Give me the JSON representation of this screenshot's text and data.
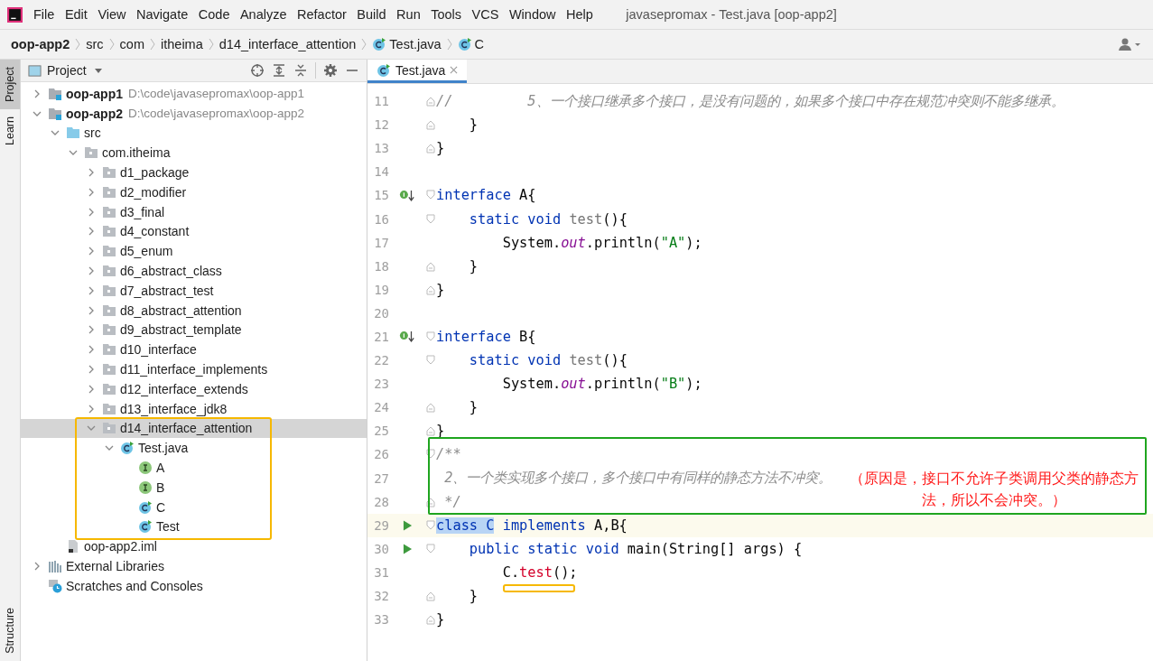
{
  "window": {
    "title": "javasepromax - Test.java [oop-app2]"
  },
  "menu": [
    "File",
    "Edit",
    "View",
    "Navigate",
    "Code",
    "Analyze",
    "Refactor",
    "Build",
    "Run",
    "Tools",
    "VCS",
    "Window",
    "Help"
  ],
  "breadcrumbs": [
    {
      "label": "oop-app2",
      "kind": "module"
    },
    {
      "label": "src",
      "kind": "folder"
    },
    {
      "label": "com",
      "kind": "folder"
    },
    {
      "label": "itheima",
      "kind": "folder"
    },
    {
      "label": "d14_interface_attention",
      "kind": "folder"
    },
    {
      "label": "Test.java",
      "kind": "class"
    },
    {
      "label": "C",
      "kind": "class"
    }
  ],
  "side_tabs": [
    {
      "label": "Project",
      "selected": true
    },
    {
      "label": "Learn",
      "selected": false
    }
  ],
  "bottom_side_tab": "Structure",
  "project": {
    "title": "Project",
    "tree": [
      {
        "label": "oop-app1",
        "path": "D:\\code\\javasepromax\\oop-app1",
        "kind": "module",
        "expanded": false,
        "selected": false
      },
      {
        "label": "oop-app2",
        "path": "D:\\code\\javasepromax\\oop-app2",
        "kind": "module",
        "expanded": true,
        "selected": false,
        "children": [
          {
            "label": "src",
            "kind": "source",
            "expanded": true,
            "selected": false,
            "children": [
              {
                "label": "com.itheima",
                "kind": "package",
                "expanded": true,
                "selected": false,
                "children": [
                  {
                    "label": "d1_package",
                    "kind": "package",
                    "expanded": false,
                    "selected": false
                  },
                  {
                    "label": "d2_modifier",
                    "kind": "package",
                    "expanded": false,
                    "selected": false
                  },
                  {
                    "label": "d3_final",
                    "kind": "package",
                    "expanded": false,
                    "selected": false
                  },
                  {
                    "label": "d4_constant",
                    "kind": "package",
                    "expanded": false,
                    "selected": false
                  },
                  {
                    "label": "d5_enum",
                    "kind": "package",
                    "expanded": false,
                    "selected": false
                  },
                  {
                    "label": "d6_abstract_class",
                    "kind": "package",
                    "expanded": false,
                    "selected": false
                  },
                  {
                    "label": "d7_abstract_test",
                    "kind": "package",
                    "expanded": false,
                    "selected": false
                  },
                  {
                    "label": "d8_abstract_attention",
                    "kind": "package",
                    "expanded": false,
                    "selected": false
                  },
                  {
                    "label": "d9_abstract_template",
                    "kind": "package",
                    "expanded": false,
                    "selected": false
                  },
                  {
                    "label": "d10_interface",
                    "kind": "package",
                    "expanded": false,
                    "selected": false
                  },
                  {
                    "label": "d11_interface_implements",
                    "kind": "package",
                    "expanded": false,
                    "selected": false
                  },
                  {
                    "label": "d12_interface_extends",
                    "kind": "package",
                    "expanded": false,
                    "selected": false
                  },
                  {
                    "label": "d13_interface_jdk8",
                    "kind": "package",
                    "expanded": false,
                    "selected": false
                  },
                  {
                    "label": "d14_interface_attention",
                    "kind": "package",
                    "expanded": true,
                    "selected": true,
                    "children": [
                      {
                        "label": "Test.java",
                        "kind": "class",
                        "expanded": true,
                        "selected": false,
                        "children": [
                          {
                            "label": "A",
                            "kind": "interface",
                            "selected": false
                          },
                          {
                            "label": "B",
                            "kind": "interface",
                            "selected": false
                          },
                          {
                            "label": "C",
                            "kind": "class",
                            "selected": false
                          },
                          {
                            "label": "Test",
                            "kind": "class",
                            "selected": false
                          }
                        ]
                      }
                    ]
                  }
                ]
              }
            ]
          },
          {
            "label": "oop-app2.iml",
            "kind": "file",
            "selected": false
          }
        ]
      },
      {
        "label": "External Libraries",
        "kind": "libraries",
        "expanded": false,
        "selected": false
      },
      {
        "label": "Scratches and Consoles",
        "kind": "scratches",
        "selected": false
      }
    ]
  },
  "editor_tabs": [
    {
      "label": "Test.java",
      "selected": true
    }
  ],
  "code": [
    {
      "number": "11",
      "current": false,
      "fold": {
        "kind": "close"
      },
      "tokens": [
        {
          "t": "//         5、一个接口继承多个接口，是没有问题的，如果多个接口中存在规范冲突则不能多继承。",
          "kind": "comment"
        }
      ]
    },
    {
      "number": "12",
      "current": false,
      "fold": {
        "kind": "close"
      },
      "tokens": [
        {
          "t": "    }",
          "kind": "plain"
        }
      ]
    },
    {
      "number": "13",
      "current": false,
      "fold": {
        "kind": "close"
      },
      "tokens": [
        {
          "t": "}",
          "kind": "plain"
        }
      ]
    },
    {
      "number": "14",
      "current": false
    },
    {
      "number": "15",
      "current": false,
      "fold": {
        "kind": "open"
      },
      "gutter": {
        "kind": "implemented"
      },
      "tokens": [
        {
          "t": "interface",
          "kind": "keyword"
        },
        {
          "t": " A{",
          "kind": "plain"
        }
      ]
    },
    {
      "number": "16",
      "current": false,
      "fold": {
        "kind": "open"
      },
      "tokens": [
        {
          "t": "    static",
          "kind": "keyword"
        },
        {
          "t": " void",
          "kind": "keyword"
        },
        {
          "t": " test",
          "kind": "unused"
        },
        {
          "t": "(){",
          "kind": "plain"
        }
      ]
    },
    {
      "number": "17",
      "current": false,
      "tokens": [
        {
          "t": "        System.",
          "kind": "plain"
        },
        {
          "t": "out",
          "kind": "field"
        },
        {
          "t": ".println(",
          "kind": "plain"
        },
        {
          "t": "\"A\"",
          "kind": "string"
        },
        {
          "t": ");",
          "kind": "plain"
        }
      ]
    },
    {
      "number": "18",
      "current": false,
      "fold": {
        "kind": "close"
      },
      "tokens": [
        {
          "t": "    }",
          "kind": "plain"
        }
      ]
    },
    {
      "number": "19",
      "current": false,
      "fold": {
        "kind": "close"
      },
      "tokens": [
        {
          "t": "}",
          "kind": "plain"
        }
      ]
    },
    {
      "number": "20",
      "current": false
    },
    {
      "number": "21",
      "current": false,
      "fold": {
        "kind": "open"
      },
      "gutter": {
        "kind": "implemented"
      },
      "tokens": [
        {
          "t": "interface",
          "kind": "keyword"
        },
        {
          "t": " B{",
          "kind": "plain"
        }
      ]
    },
    {
      "number": "22",
      "current": false,
      "fold": {
        "kind": "open"
      },
      "tokens": [
        {
          "t": "    static",
          "kind": "keyword"
        },
        {
          "t": " void",
          "kind": "keyword"
        },
        {
          "t": " test",
          "kind": "unused"
        },
        {
          "t": "(){",
          "kind": "plain"
        }
      ]
    },
    {
      "number": "23",
      "current": false,
      "tokens": [
        {
          "t": "        System.",
          "kind": "plain"
        },
        {
          "t": "out",
          "kind": "field"
        },
        {
          "t": ".println(",
          "kind": "plain"
        },
        {
          "t": "\"B\"",
          "kind": "string"
        },
        {
          "t": ");",
          "kind": "plain"
        }
      ]
    },
    {
      "number": "24",
      "current": false,
      "fold": {
        "kind": "close"
      },
      "tokens": [
        {
          "t": "    }",
          "kind": "plain"
        }
      ]
    },
    {
      "number": "25",
      "current": false,
      "fold": {
        "kind": "close"
      },
      "tokens": [
        {
          "t": "}",
          "kind": "plain"
        }
      ]
    },
    {
      "number": "26",
      "current": false,
      "fold": {
        "kind": "open"
      },
      "tokens": [
        {
          "t": "/**",
          "kind": "comment"
        }
      ]
    },
    {
      "number": "27",
      "current": false,
      "tokens": [
        {
          "t": " 2、一个类实现多个接口，多个接口中有同样的静态方法不冲突。",
          "kind": "comment"
        }
      ]
    },
    {
      "number": "28",
      "current": false,
      "fold": {
        "kind": "close"
      },
      "tokens": [
        {
          "t": " */",
          "kind": "comment"
        }
      ]
    },
    {
      "number": "29",
      "current": true,
      "fold": {
        "kind": "open"
      },
      "gutter": {
        "kind": "run"
      },
      "tokens": [
        {
          "t": "class C",
          "kind": "selection"
        },
        {
          "t": " implements",
          "kind": "keyword"
        },
        {
          "t": " A,B{",
          "kind": "plain"
        }
      ]
    },
    {
      "number": "30",
      "current": false,
      "fold": {
        "kind": "open"
      },
      "gutter": {
        "kind": "run"
      },
      "tokens": [
        {
          "t": "    public",
          "kind": "keyword"
        },
        {
          "t": " static",
          "kind": "keyword"
        },
        {
          "t": " void",
          "kind": "keyword"
        },
        {
          "t": " main(String[] args) {",
          "kind": "plain"
        }
      ]
    },
    {
      "number": "31",
      "current": false,
      "tokens": [
        {
          "t": "        C.",
          "kind": "plain"
        },
        {
          "t": "test",
          "kind": "error"
        },
        {
          "t": "();",
          "kind": "plain"
        }
      ]
    },
    {
      "number": "32",
      "current": false,
      "fold": {
        "kind": "close"
      },
      "tokens": [
        {
          "t": "    }",
          "kind": "plain"
        }
      ]
    },
    {
      "number": "33",
      "current": false,
      "fold": {
        "kind": "close"
      },
      "tokens": [
        {
          "t": "}",
          "kind": "plain"
        }
      ]
    }
  ],
  "annotation": "（原因是，接口不允许子类调用父类的静态方法，所以不会冲突。）"
}
